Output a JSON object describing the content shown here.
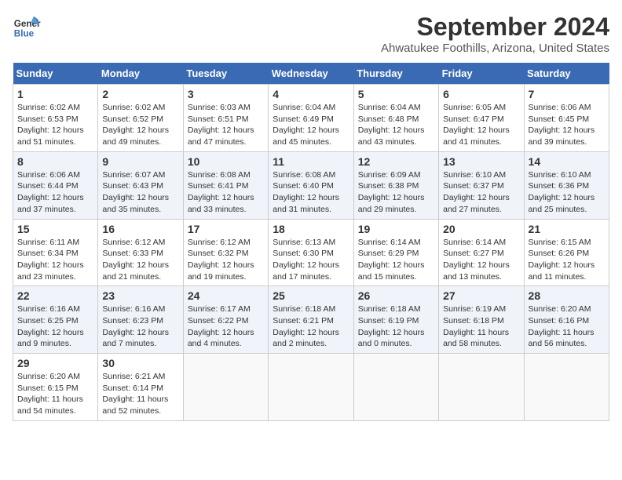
{
  "header": {
    "logo_line1": "General",
    "logo_line2": "Blue",
    "title": "September 2024",
    "subtitle": "Ahwatukee Foothills, Arizona, United States"
  },
  "days_of_week": [
    "Sunday",
    "Monday",
    "Tuesday",
    "Wednesday",
    "Thursday",
    "Friday",
    "Saturday"
  ],
  "weeks": [
    [
      {
        "day": "1",
        "info": "Sunrise: 6:02 AM\nSunset: 6:53 PM\nDaylight: 12 hours\nand 51 minutes."
      },
      {
        "day": "2",
        "info": "Sunrise: 6:02 AM\nSunset: 6:52 PM\nDaylight: 12 hours\nand 49 minutes."
      },
      {
        "day": "3",
        "info": "Sunrise: 6:03 AM\nSunset: 6:51 PM\nDaylight: 12 hours\nand 47 minutes."
      },
      {
        "day": "4",
        "info": "Sunrise: 6:04 AM\nSunset: 6:49 PM\nDaylight: 12 hours\nand 45 minutes."
      },
      {
        "day": "5",
        "info": "Sunrise: 6:04 AM\nSunset: 6:48 PM\nDaylight: 12 hours\nand 43 minutes."
      },
      {
        "day": "6",
        "info": "Sunrise: 6:05 AM\nSunset: 6:47 PM\nDaylight: 12 hours\nand 41 minutes."
      },
      {
        "day": "7",
        "info": "Sunrise: 6:06 AM\nSunset: 6:45 PM\nDaylight: 12 hours\nand 39 minutes."
      }
    ],
    [
      {
        "day": "8",
        "info": "Sunrise: 6:06 AM\nSunset: 6:44 PM\nDaylight: 12 hours\nand 37 minutes."
      },
      {
        "day": "9",
        "info": "Sunrise: 6:07 AM\nSunset: 6:43 PM\nDaylight: 12 hours\nand 35 minutes."
      },
      {
        "day": "10",
        "info": "Sunrise: 6:08 AM\nSunset: 6:41 PM\nDaylight: 12 hours\nand 33 minutes."
      },
      {
        "day": "11",
        "info": "Sunrise: 6:08 AM\nSunset: 6:40 PM\nDaylight: 12 hours\nand 31 minutes."
      },
      {
        "day": "12",
        "info": "Sunrise: 6:09 AM\nSunset: 6:38 PM\nDaylight: 12 hours\nand 29 minutes."
      },
      {
        "day": "13",
        "info": "Sunrise: 6:10 AM\nSunset: 6:37 PM\nDaylight: 12 hours\nand 27 minutes."
      },
      {
        "day": "14",
        "info": "Sunrise: 6:10 AM\nSunset: 6:36 PM\nDaylight: 12 hours\nand 25 minutes."
      }
    ],
    [
      {
        "day": "15",
        "info": "Sunrise: 6:11 AM\nSunset: 6:34 PM\nDaylight: 12 hours\nand 23 minutes."
      },
      {
        "day": "16",
        "info": "Sunrise: 6:12 AM\nSunset: 6:33 PM\nDaylight: 12 hours\nand 21 minutes."
      },
      {
        "day": "17",
        "info": "Sunrise: 6:12 AM\nSunset: 6:32 PM\nDaylight: 12 hours\nand 19 minutes."
      },
      {
        "day": "18",
        "info": "Sunrise: 6:13 AM\nSunset: 6:30 PM\nDaylight: 12 hours\nand 17 minutes."
      },
      {
        "day": "19",
        "info": "Sunrise: 6:14 AM\nSunset: 6:29 PM\nDaylight: 12 hours\nand 15 minutes."
      },
      {
        "day": "20",
        "info": "Sunrise: 6:14 AM\nSunset: 6:27 PM\nDaylight: 12 hours\nand 13 minutes."
      },
      {
        "day": "21",
        "info": "Sunrise: 6:15 AM\nSunset: 6:26 PM\nDaylight: 12 hours\nand 11 minutes."
      }
    ],
    [
      {
        "day": "22",
        "info": "Sunrise: 6:16 AM\nSunset: 6:25 PM\nDaylight: 12 hours\nand 9 minutes."
      },
      {
        "day": "23",
        "info": "Sunrise: 6:16 AM\nSunset: 6:23 PM\nDaylight: 12 hours\nand 7 minutes."
      },
      {
        "day": "24",
        "info": "Sunrise: 6:17 AM\nSunset: 6:22 PM\nDaylight: 12 hours\nand 4 minutes."
      },
      {
        "day": "25",
        "info": "Sunrise: 6:18 AM\nSunset: 6:21 PM\nDaylight: 12 hours\nand 2 minutes."
      },
      {
        "day": "26",
        "info": "Sunrise: 6:18 AM\nSunset: 6:19 PM\nDaylight: 12 hours\nand 0 minutes."
      },
      {
        "day": "27",
        "info": "Sunrise: 6:19 AM\nSunset: 6:18 PM\nDaylight: 11 hours\nand 58 minutes."
      },
      {
        "day": "28",
        "info": "Sunrise: 6:20 AM\nSunset: 6:16 PM\nDaylight: 11 hours\nand 56 minutes."
      }
    ],
    [
      {
        "day": "29",
        "info": "Sunrise: 6:20 AM\nSunset: 6:15 PM\nDaylight: 11 hours\nand 54 minutes."
      },
      {
        "day": "30",
        "info": "Sunrise: 6:21 AM\nSunset: 6:14 PM\nDaylight: 11 hours\nand 52 minutes."
      },
      {
        "day": "",
        "info": ""
      },
      {
        "day": "",
        "info": ""
      },
      {
        "day": "",
        "info": ""
      },
      {
        "day": "",
        "info": ""
      },
      {
        "day": "",
        "info": ""
      }
    ]
  ]
}
